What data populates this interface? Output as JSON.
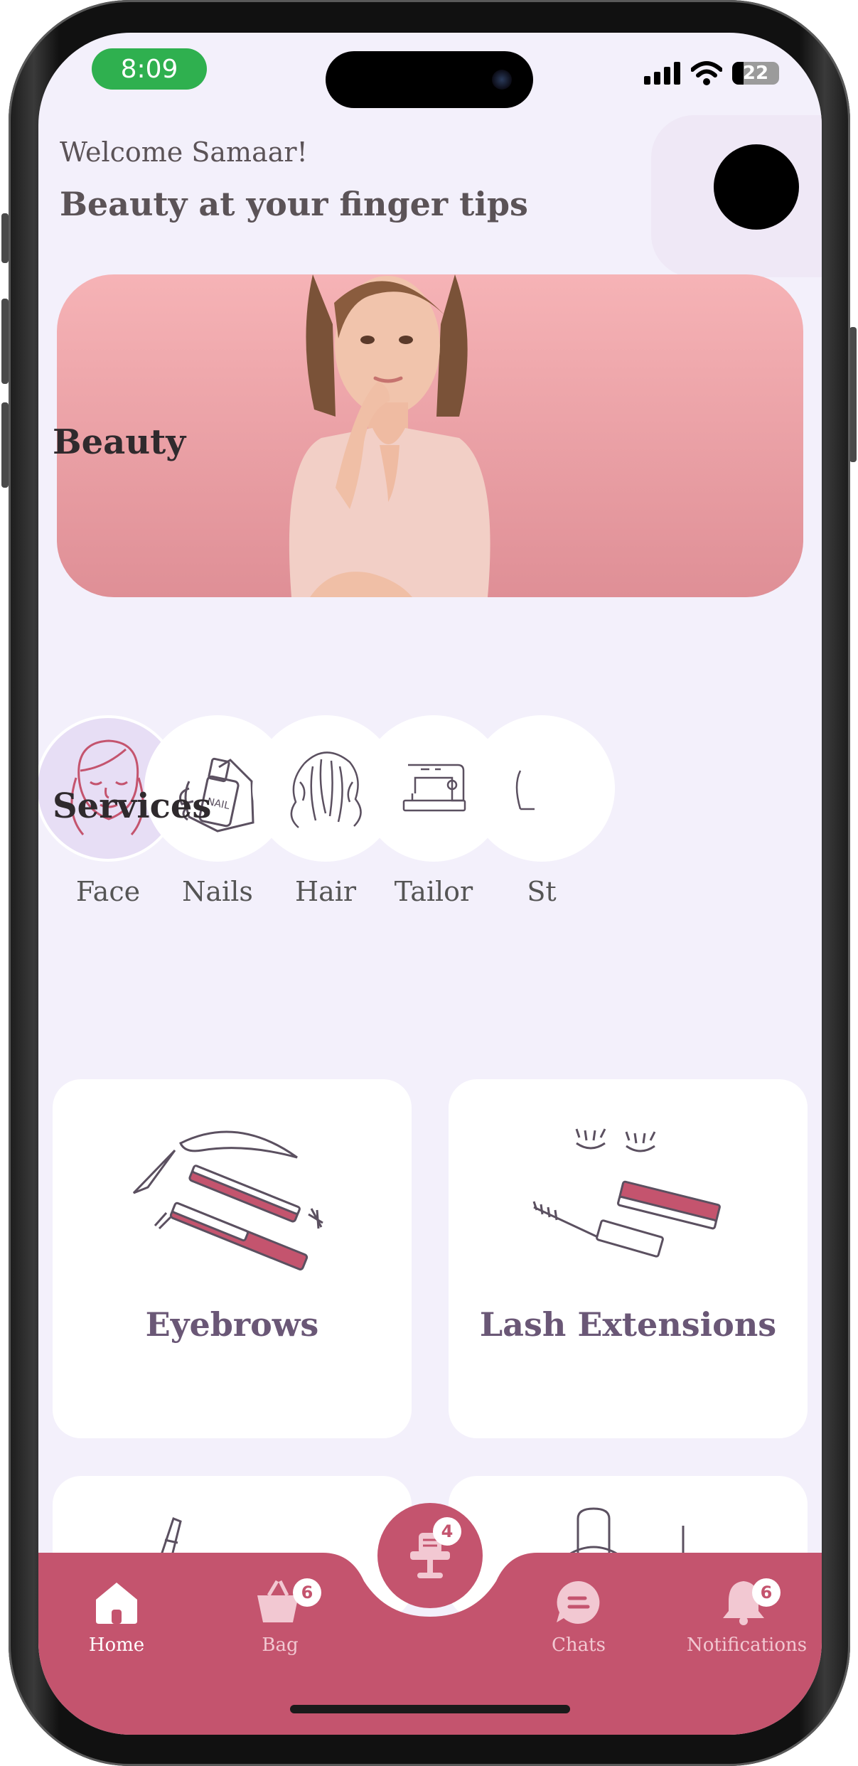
{
  "status_bar": {
    "time": "8:09",
    "battery": "22"
  },
  "header": {
    "welcome": "Welcome Samaar!",
    "tagline": "Beauty at your finger tips"
  },
  "sections": {
    "beauty": "Beauty",
    "services": "Services"
  },
  "categories": [
    {
      "label": "Face",
      "icon": "face-icon",
      "active": true
    },
    {
      "label": "Nails",
      "icon": "nail-polish-icon"
    },
    {
      "label": "Hair",
      "icon": "hair-icon"
    },
    {
      "label": "Tailor",
      "icon": "sewing-machine-icon"
    },
    {
      "label": "St",
      "icon": "styling-icon"
    }
  ],
  "services": [
    {
      "label": "Eyebrows",
      "icon": "eyebrow-tools-icon"
    },
    {
      "label": "Lash Extensions",
      "icon": "lash-mascara-icon"
    }
  ],
  "nav": {
    "items": [
      {
        "label": "Home",
        "icon": "home-icon",
        "active": true
      },
      {
        "label": "Bag",
        "icon": "bag-icon",
        "badge": "6"
      },
      {
        "label": "Chats",
        "icon": "chat-icon"
      },
      {
        "label": "Notifications",
        "icon": "bell-icon",
        "badge": "6"
      }
    ],
    "center": {
      "icon": "salon-chair-icon",
      "badge": "4"
    }
  },
  "colors": {
    "accent": "#c4546e",
    "background": "#f3f0fb",
    "card_title": "#6a5776",
    "status_pill": "#2fb04f"
  }
}
